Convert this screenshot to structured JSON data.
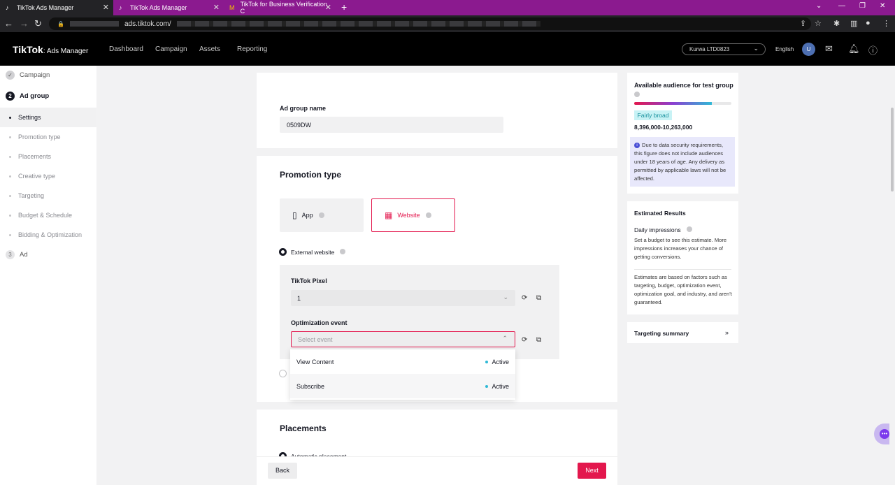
{
  "browser": {
    "tabs": [
      {
        "title": "TikTok Ads Manager",
        "active": true
      },
      {
        "title": "TikTok Ads Manager",
        "active": false
      },
      {
        "title": "TikTok for Business Verification C",
        "active": false
      }
    ],
    "url": "ads.tiktok.com/"
  },
  "header": {
    "logo_main": "TikTok",
    "logo_sub": ": Ads Manager",
    "nav": [
      "Dashboard",
      "Campaign",
      "Assets",
      "Reporting"
    ],
    "account": "Kurwa LTD0823",
    "language": "English",
    "avatar_letter": "U"
  },
  "sidebar": {
    "steps": [
      {
        "badge": "✓",
        "label": "Campaign"
      },
      {
        "badge": "2",
        "label": "Ad group"
      },
      {
        "badge": "3",
        "label": "Ad"
      }
    ],
    "sub_items": [
      "Settings",
      "Promotion type",
      "Placements",
      "Creative type",
      "Targeting",
      "Budget & Schedule",
      "Bidding & Optimization"
    ]
  },
  "adgroup": {
    "name_label": "Ad group name",
    "name_value": "0509DW"
  },
  "promotion": {
    "title": "Promotion type",
    "options": [
      "App",
      "Website"
    ],
    "selected": "Website",
    "external_label": "External website",
    "pixel_label": "TikTok Pixel",
    "pixel_value": "1",
    "event_label": "Optimization event",
    "event_placeholder": "Select event",
    "events": [
      {
        "name": "View Content",
        "status": "Active"
      },
      {
        "name": "Subscribe",
        "status": "Active"
      }
    ]
  },
  "placements": {
    "title": "Placements",
    "option": "Automatic placement"
  },
  "footer": {
    "back": "Back",
    "next": "Next"
  },
  "audience": {
    "title": "Available audience for test group",
    "level": "Fairly broad",
    "range": "8,396,000-10,263,000",
    "fill_fraction": 0.8,
    "notice": "Due to data security requirements, this figure does not include audiences under 18 years of age. Any delivery as permitted by applicable laws will not be affected."
  },
  "estimates": {
    "title": "Estimated Results",
    "daily_label": "Daily impressions",
    "daily_text": "Set a budget to see this estimate. More impressions increases your chance of getting conversions.",
    "disclaimer": "Estimates are based on factors such as targeting, budget, optimization event, optimization goal, and industry, and aren't guaranteed."
  },
  "targeting_summary": {
    "title": "Targeting summary"
  },
  "colors": {
    "accent": "#e3174d",
    "tabstrip": "#8b1a8f",
    "info_bg": "#e8e8fb",
    "active_dot": "#2fb9d6"
  }
}
